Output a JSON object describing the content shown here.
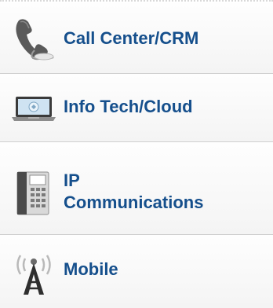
{
  "menu": {
    "items": [
      {
        "label": "Call Center/CRM",
        "icon": "phone-headset-icon"
      },
      {
        "label": "Info Tech/Cloud",
        "icon": "laptop-icon"
      },
      {
        "label_line1": "IP",
        "label_line2": "Communications",
        "icon": "ip-phone-icon"
      },
      {
        "label": "Mobile",
        "icon": "antenna-tower-icon"
      }
    ]
  }
}
